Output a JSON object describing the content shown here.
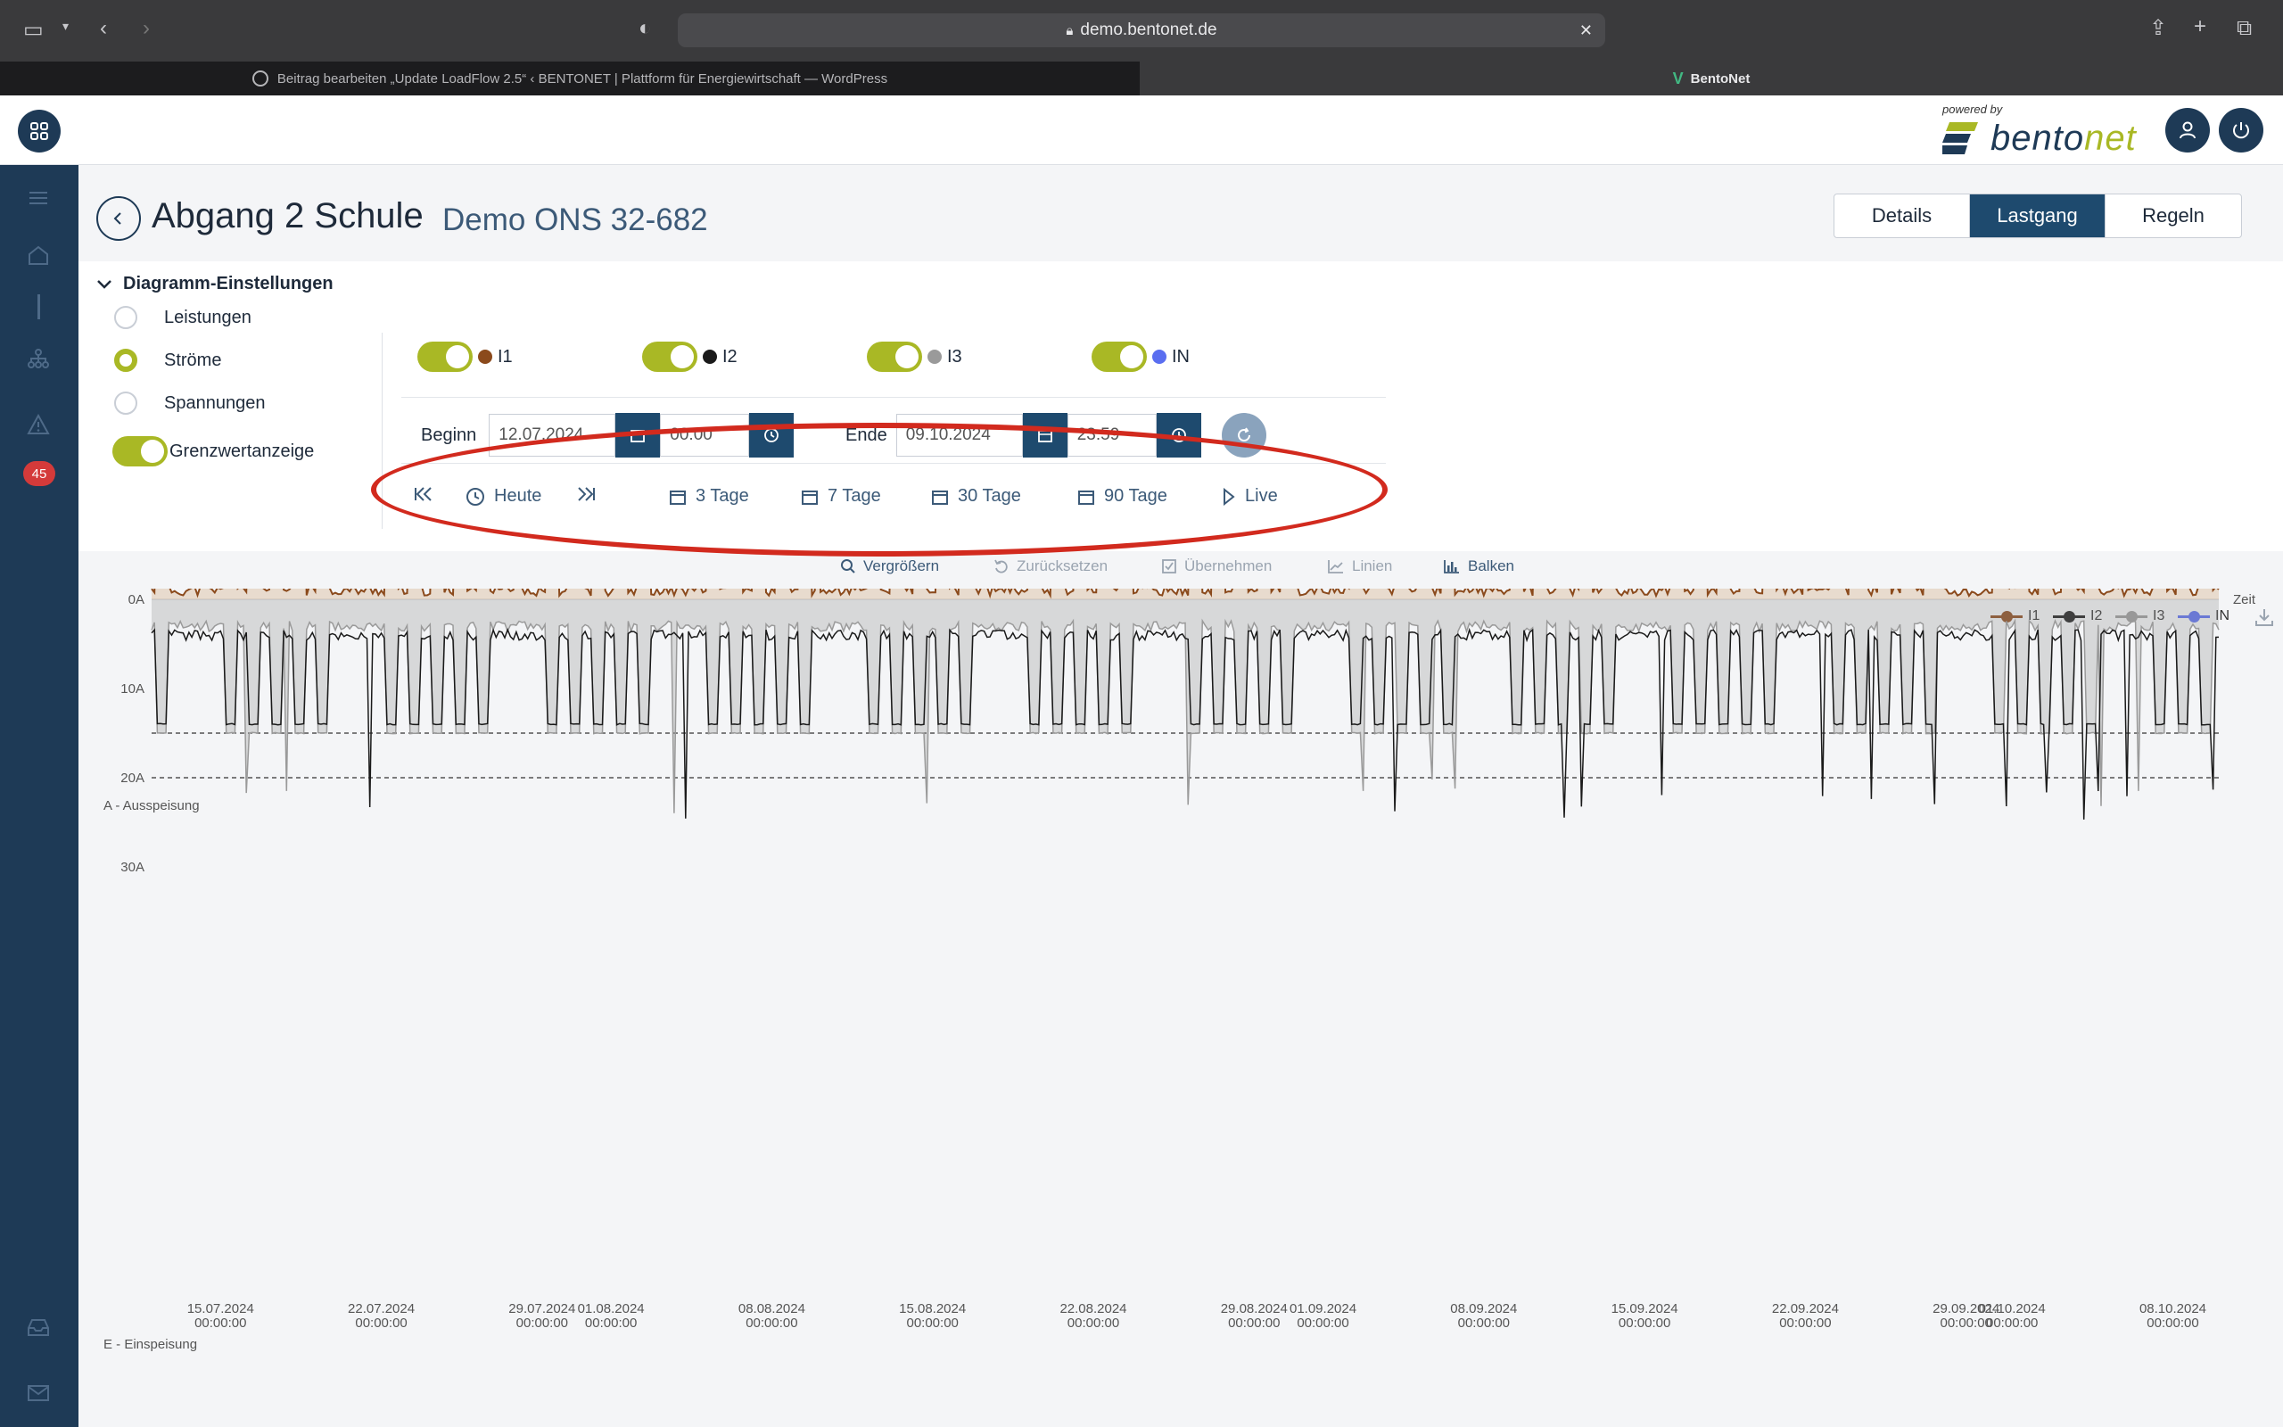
{
  "browser": {
    "url": "demo.bentonet.de",
    "tabs": [
      {
        "label": "Beitrag bearbeiten „Update LoadFlow 2.5“ ‹ BENTONET | Plattform für Energiewirtschaft — WordPress"
      },
      {
        "label": "BentoNet"
      }
    ]
  },
  "header": {
    "powered_by": "powered by",
    "brand_part1": "bento",
    "brand_part2": "net"
  },
  "sidebar": {
    "badge_count": "45"
  },
  "page": {
    "title": "Abgang 2 Schule",
    "subtitle": "Demo ONS 32-682",
    "view_tabs": [
      "Details",
      "Lastgang",
      "Regeln"
    ],
    "active_tab": "Lastgang"
  },
  "settings": {
    "heading": "Diagramm-Einstellungen",
    "modes": [
      "Leistungen",
      "Ströme",
      "Spannungen"
    ],
    "selected_mode": "Ströme",
    "limit_toggle": "Grenzwertanzeige",
    "phases": [
      {
        "label": "I1",
        "color": "#8b4a1c"
      },
      {
        "label": "I2",
        "color": "#1a1a1a"
      },
      {
        "label": "I3",
        "color": "#9a9a9a"
      },
      {
        "label": "IN",
        "color": "#5a6ef0"
      }
    ],
    "begin_label": "Beginn",
    "begin_date": "12.07.2024",
    "begin_time": "00:00",
    "end_label": "Ende",
    "end_date": "09.10.2024",
    "end_time": "23:59",
    "nav": {
      "today": "Heute",
      "ranges": [
        "3 Tage",
        "7 Tage",
        "30 Tage",
        "90 Tage"
      ],
      "live": "Live"
    }
  },
  "toolbar": {
    "zoom": "Vergrößern",
    "reset": "Zurücksetzen",
    "apply": "Übernehmen",
    "lines": "Linien",
    "bars": "Balken"
  },
  "chart_data": {
    "type": "line",
    "title": "",
    "ylabel_top": "A - Ausspeisung",
    "ylabel_bottom": "E - Einspeisung",
    "xlabel": "Zeit",
    "y_ticks": [
      "20A",
      "10A",
      "0A",
      "10A",
      "20A",
      "30A"
    ],
    "y_values": [
      20,
      10,
      0,
      -10,
      -20,
      -30
    ],
    "ylim": [
      -30,
      20
    ],
    "limit_lines": [
      20,
      15,
      -15,
      -20
    ],
    "x_ticks": [
      {
        "date": "15.07.2024",
        "time": "00:00:00"
      },
      {
        "date": "22.07.2024",
        "time": "00:00:00"
      },
      {
        "date": "29.07.2024",
        "time": "00:00:00"
      },
      {
        "date": "01.08.2024",
        "time": "00:00:00"
      },
      {
        "date": "08.08.2024",
        "time": "00:00:00"
      },
      {
        "date": "15.08.2024",
        "time": "00:00:00"
      },
      {
        "date": "22.08.2024",
        "time": "00:00:00"
      },
      {
        "date": "29.08.2024",
        "time": "00:00:00"
      },
      {
        "date": "01.09.2024",
        "time": "00:00:00"
      },
      {
        "date": "08.09.2024",
        "time": "00:00:00"
      },
      {
        "date": "15.09.2024",
        "time": "00:00:00"
      },
      {
        "date": "22.09.2024",
        "time": "00:00:00"
      },
      {
        "date": "29.09.2024",
        "time": "00:00:00"
      },
      {
        "date": "01.10.2024",
        "time": "00:00:00"
      },
      {
        "date": "08.10.2024",
        "time": "00:00:00"
      }
    ],
    "x_range": [
      "12.07.2024",
      "09.10.2024"
    ],
    "series": [
      {
        "name": "I1",
        "color": "#8b4a1c",
        "low": 1,
        "high": 13,
        "baseline": 1,
        "peak_max": 20
      },
      {
        "name": "I2",
        "color": "#1a1a1a",
        "low": -15,
        "high": -2,
        "baseline": -4,
        "peak_min": -25
      },
      {
        "name": "I3",
        "color": "#9a9a9a",
        "low": -16,
        "high": -1,
        "baseline": -3,
        "peak_min": -24
      },
      {
        "name": "IN",
        "color": "#5a6ef0",
        "low": 3,
        "high": 9,
        "baseline": 5
      }
    ],
    "legend_position": "top-right",
    "grid": false
  }
}
